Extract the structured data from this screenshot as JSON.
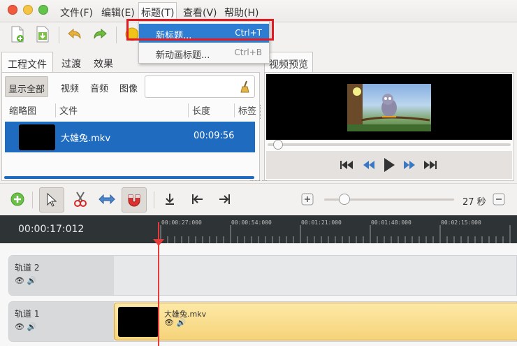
{
  "menubar": {
    "items": [
      "文件(F)",
      "编辑(E)",
      "标题(T)",
      "查看(V)",
      "帮助(H)"
    ]
  },
  "title_menu": {
    "items": [
      {
        "label": "新标题...",
        "shortcut": "Ctrl+T"
      },
      {
        "label": "新动画标题...",
        "shortcut": "Ctrl+B"
      }
    ]
  },
  "toolbar": {
    "icons": [
      "new-project-icon",
      "import-files-icon",
      "undo-icon",
      "redo-icon",
      "add-icon"
    ]
  },
  "project_panel": {
    "tabs": [
      "工程文件",
      "过渡",
      "效果"
    ],
    "filters": [
      "显示全部",
      "视频",
      "音频",
      "图像"
    ],
    "columns": [
      "缩略图",
      "文件",
      "长度",
      "标签"
    ],
    "files": [
      {
        "name": "大雄兔.mkv",
        "length": "00:09:56"
      }
    ]
  },
  "preview_panel": {
    "tab": "视频预览"
  },
  "timeline": {
    "zoom_label": "27 秒",
    "timecode": "00:00:17:012",
    "ruler_labels": [
      "00:00:27:000",
      "00:00:54:000",
      "00:01:21:000",
      "00:01:48:000",
      "00:02:15:000"
    ],
    "tracks": [
      {
        "name": "轨道 2",
        "clips": []
      },
      {
        "name": "轨道 1",
        "clips": [
          {
            "name": "大雄兔.mkv"
          }
        ]
      }
    ]
  },
  "colors": {
    "selection": "#1f6bbf",
    "menu_highlight": "#2d7dd3",
    "playhead": "#e63b3b",
    "clip": "#f6d37a",
    "annotation_box": "#e01b24"
  }
}
